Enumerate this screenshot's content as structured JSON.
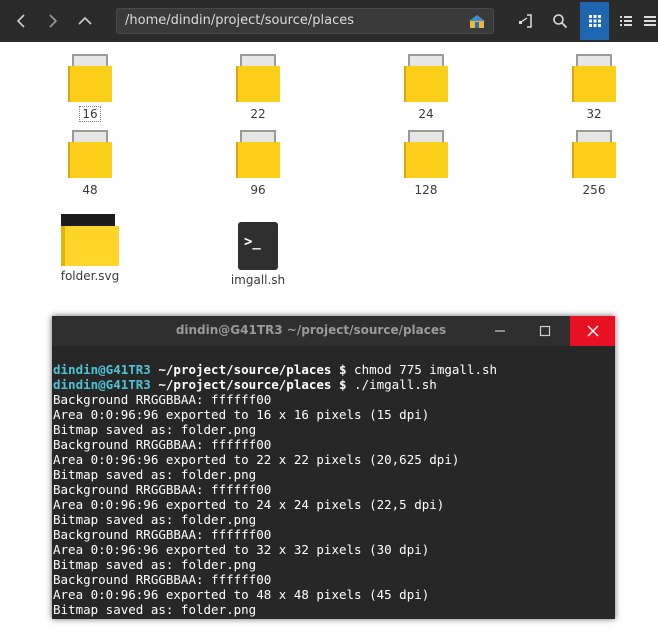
{
  "header": {
    "path": "/home/dindin/project/source/places",
    "buttons": {
      "back": "chevron-left-icon",
      "forward": "chevron-right-icon",
      "up": "chevron-up-icon",
      "open_terminal": "open-terminal-icon",
      "search": "search-icon",
      "grid_view": "grid-view-icon",
      "list_view": "list-view-icon",
      "menu": "hamburger-icon"
    }
  },
  "files": [
    {
      "name": "16",
      "type": "folder"
    },
    {
      "name": "22",
      "type": "folder"
    },
    {
      "name": "24",
      "type": "folder"
    },
    {
      "name": "32",
      "type": "folder"
    },
    {
      "name": "48",
      "type": "folder"
    },
    {
      "name": "96",
      "type": "folder"
    },
    {
      "name": "128",
      "type": "folder"
    },
    {
      "name": "256",
      "type": "folder"
    },
    {
      "name": "folder.svg",
      "type": "svg-image"
    },
    {
      "name": "imgall.sh",
      "type": "shell-script"
    }
  ],
  "terminal": {
    "title": "dindin@G41TR3 ~/project/source/places",
    "prompt_user": "dindin@G41TR3",
    "prompt_path": " ~/project/source/places $",
    "commands": [
      " chmod 775 imgall.sh",
      " ./imgall.sh"
    ],
    "output": [
      "Background RRGGBBAA: ffffff00",
      "Area 0:0:96:96 exported to 16 x 16 pixels (15 dpi)",
      "Bitmap saved as: folder.png",
      "Background RRGGBBAA: ffffff00",
      "Area 0:0:96:96 exported to 22 x 22 pixels (20,625 dpi)",
      "Bitmap saved as: folder.png",
      "Background RRGGBBAA: ffffff00",
      "Area 0:0:96:96 exported to 24 x 24 pixels (22,5 dpi)",
      "Bitmap saved as: folder.png",
      "Background RRGGBBAA: ffffff00",
      "Area 0:0:96:96 exported to 32 x 32 pixels (30 dpi)",
      "Bitmap saved as: folder.png",
      "Background RRGGBBAA: ffffff00",
      "Area 0:0:96:96 exported to 48 x 48 pixels (45 dpi)",
      "Bitmap saved as: folder.png"
    ]
  },
  "colors": {
    "header_bg": "#2b2b2b",
    "accent": "#1e66b0",
    "folder_yellow": "#fbce19",
    "terminal_bg": "#272727",
    "prompt_user": "#4fc2d8",
    "close_red": "#e81123"
  }
}
